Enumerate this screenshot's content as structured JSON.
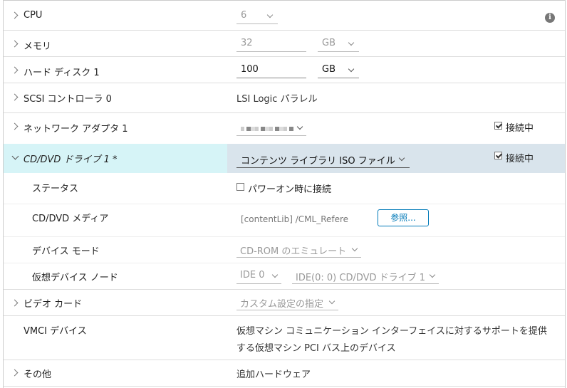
{
  "rows": {
    "cpu": {
      "label": "CPU",
      "value": "6"
    },
    "memory": {
      "label": "メモリ",
      "value": "32",
      "unit": "GB"
    },
    "hard_disk": {
      "label": "ハード ディスク 1",
      "value": "100",
      "unit": "GB"
    },
    "scsi": {
      "label": "SCSI コントローラ 0",
      "value": "LSI Logic パラレル"
    },
    "network": {
      "label": "ネットワーク アダプタ 1",
      "connected_label": "接続中",
      "connected": true
    },
    "cddvd": {
      "label": "CD/DVD ドライブ 1 *",
      "value": "コンテンツ ライブラリ ISO ファイル",
      "connected_label": "接続中",
      "connected": true
    },
    "status": {
      "label": "ステータス",
      "checkbox_label": "パワーオン時に接続",
      "checked": false
    },
    "media": {
      "label": "CD/DVD メディア",
      "value": "[contentLib] /CML_Refere",
      "button": "参照..."
    },
    "device_mode": {
      "label": "デバイス モード",
      "value": "CD-ROM のエミュレート"
    },
    "virtual_node": {
      "label": "仮想デバイス ノード",
      "bus": "IDE 0",
      "node": "IDE(0: 0) CD/DVD ドライブ 1"
    },
    "video": {
      "label": "ビデオ カード",
      "value": "カスタム設定の指定"
    },
    "vmci": {
      "label": "VMCI デバイス",
      "line1": "仮想マシン コミュニケーション インターフェイスに対するサポートを提供",
      "line2": "する仮想マシン PCI バス上のデバイス"
    },
    "other": {
      "label": "その他",
      "value": "追加ハードウェア"
    }
  },
  "colors": {
    "selected_left": "#d6f4f7",
    "selected_right": "#d9e4ec",
    "accent": "#0079b8"
  }
}
